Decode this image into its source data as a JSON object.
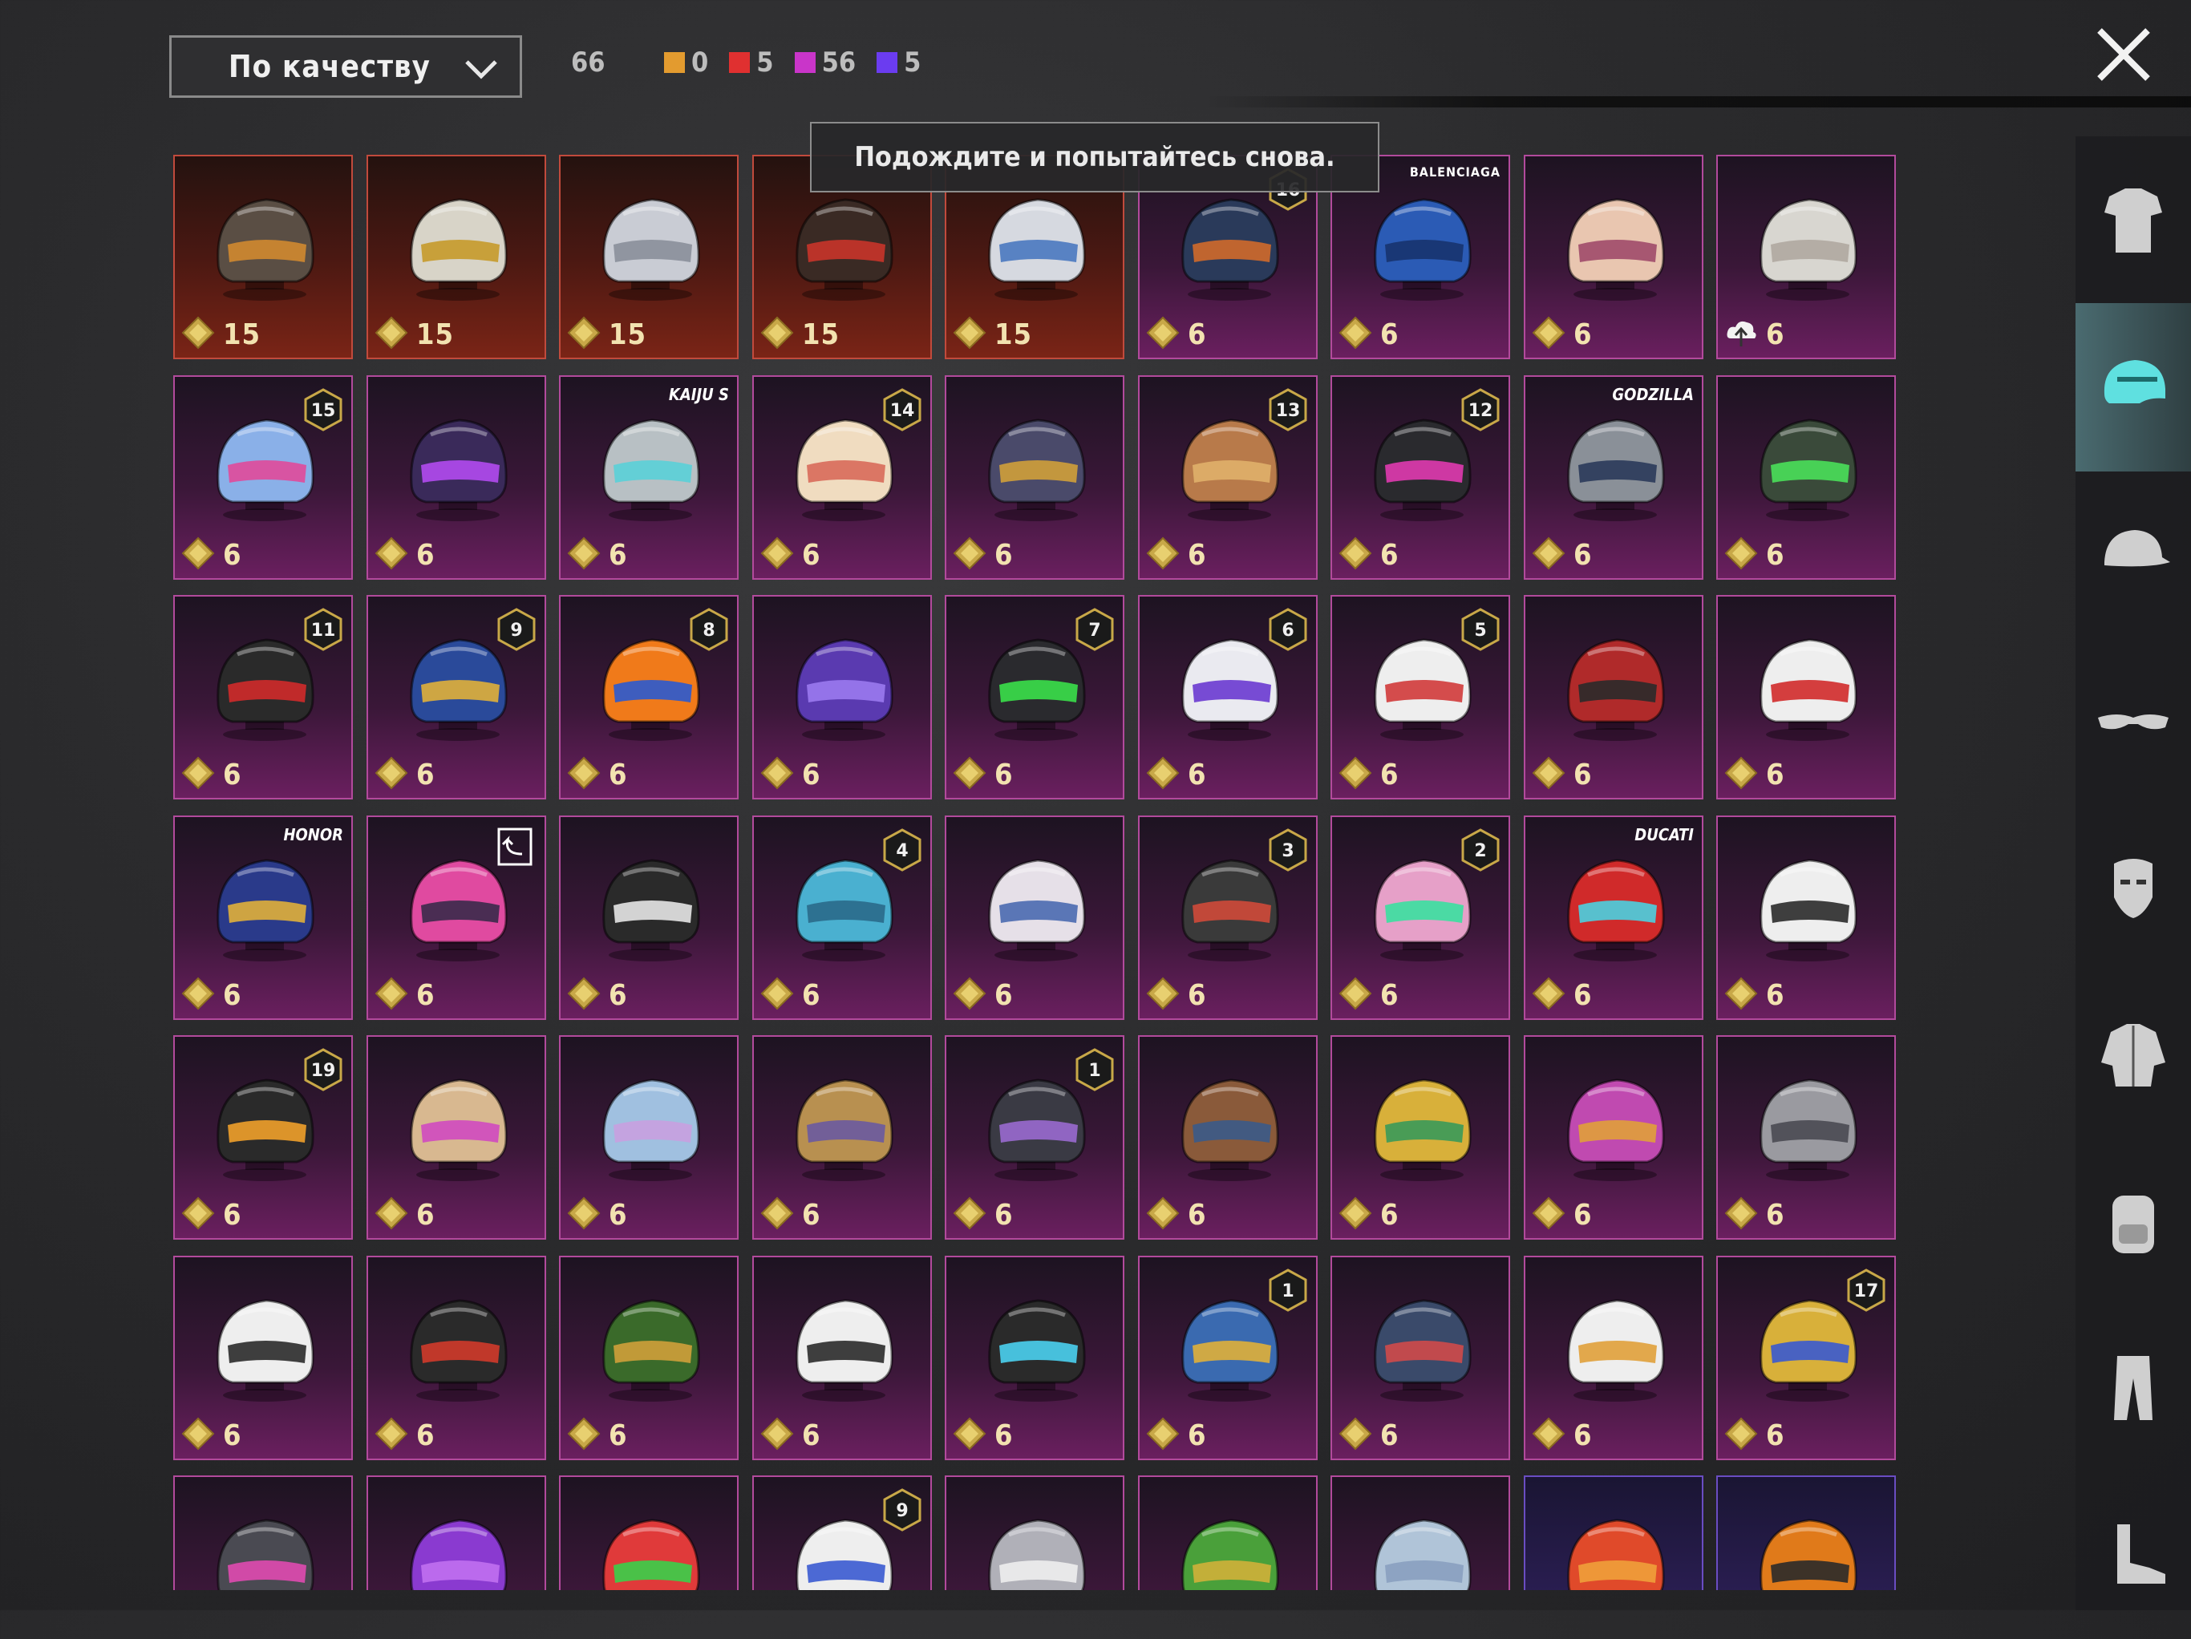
{
  "header": {
    "sort_label": "По качеству",
    "total_count": "66",
    "legend": [
      {
        "color": "#e39b2f",
        "count": "0"
      },
      {
        "color": "#e03030",
        "count": "5"
      },
      {
        "color": "#c935c9",
        "count": "56"
      },
      {
        "color": "#6b3cf0",
        "count": "5"
      }
    ]
  },
  "toast": {
    "message": "Подождите и попытайтесь снова."
  },
  "items": [
    {
      "price": "15",
      "rarity": "red",
      "color": "#5a4e44",
      "accent": "#d08a30"
    },
    {
      "price": "15",
      "rarity": "red",
      "color": "#d8d4c8",
      "accent": "#c69a2a"
    },
    {
      "price": "15",
      "rarity": "red",
      "color": "#c9ccd4",
      "accent": "#8a8f9a"
    },
    {
      "price": "15",
      "rarity": "red",
      "color": "#3a2a24",
      "accent": "#c9342a"
    },
    {
      "price": "15",
      "rarity": "red",
      "color": "#d6d9e0",
      "accent": "#4a78c0"
    },
    {
      "price": "6",
      "rarity": "purple",
      "color": "#2a3a5a",
      "accent": "#d06a2a",
      "badge": "16"
    },
    {
      "price": "6",
      "rarity": "purple",
      "color": "#2b5bb5",
      "accent": "#17336e",
      "brand": "BALENCIAGA"
    },
    {
      "price": "6",
      "rarity": "purple",
      "color": "#e9c6b0",
      "accent": "#a04a6a"
    },
    {
      "price": "6",
      "rarity": "purple",
      "color": "#d8d6d0",
      "accent": "#b0a8a0",
      "upgrade": true
    },
    {
      "price": "6",
      "rarity": "purple",
      "color": "#8ab0e8",
      "accent": "#e04a9a",
      "badge": "15"
    },
    {
      "price": "6",
      "rarity": "purple",
      "color": "#3a2a5a",
      "accent": "#b34af0"
    },
    {
      "price": "6",
      "rarity": "purple",
      "color": "#b8c0c4",
      "accent": "#5ad0d8",
      "brand": "KAIJU S"
    },
    {
      "price": "6",
      "rarity": "purple",
      "color": "#f0dcc0",
      "accent": "#d86a5a",
      "badge": "14"
    },
    {
      "price": "6",
      "rarity": "purple",
      "color": "#4a4a6a",
      "accent": "#d0a03a"
    },
    {
      "price": "6",
      "rarity": "purple",
      "color": "#b87a4a",
      "accent": "#e0b06a",
      "badge": "13"
    },
    {
      "price": "6",
      "rarity": "purple",
      "color": "#2a2a2e",
      "accent": "#e03ab0",
      "badge": "12"
    },
    {
      "price": "6",
      "rarity": "purple",
      "color": "#8a9098",
      "accent": "#2a3a5a",
      "brand": "GODZILLA"
    },
    {
      "price": "6",
      "rarity": "purple",
      "color": "#3a4a3a",
      "accent": "#4ae05a"
    },
    {
      "price": "6",
      "rarity": "purple",
      "color": "#2a2a2a",
      "accent": "#d02a2a",
      "badge": "11"
    },
    {
      "price": "6",
      "rarity": "purple",
      "color": "#2a4a9a",
      "accent": "#e0b03a",
      "badge": "9"
    },
    {
      "price": "6",
      "rarity": "purple",
      "color": "#f07a1a",
      "accent": "#2a5ad0",
      "badge": "8"
    },
    {
      "price": "6",
      "rarity": "purple",
      "color": "#5a3ab0",
      "accent": "#9a7af0"
    },
    {
      "price": "6",
      "rarity": "purple",
      "color": "#2a2a2e",
      "accent": "#3ae04a",
      "badge": "7"
    },
    {
      "price": "6",
      "rarity": "purple",
      "color": "#eaeaf0",
      "accent": "#6a3ad0",
      "badge": "6"
    },
    {
      "price": "6",
      "rarity": "purple",
      "color": "#eeeeee",
      "accent": "#d03a3a",
      "badge": "5"
    },
    {
      "price": "6",
      "rarity": "purple",
      "color": "#b02a2a",
      "accent": "#2a2a2a"
    },
    {
      "price": "6",
      "rarity": "purple",
      "color": "#eeeeee",
      "accent": "#d02a2a"
    },
    {
      "price": "6",
      "rarity": "purple",
      "color": "#2a3a8a",
      "accent": "#e0b03a",
      "brand": "HONOR"
    },
    {
      "price": "6",
      "rarity": "purple",
      "color": "#e04aa0",
      "accent": "#3a2a4a",
      "upgrade_corner": true
    },
    {
      "price": "6",
      "rarity": "purple",
      "color": "#2a2a2a",
      "accent": "#e6e6e6"
    },
    {
      "price": "6",
      "rarity": "purple",
      "color": "#4ab0d0",
      "accent": "#2a6a8a",
      "badge": "4"
    },
    {
      "price": "6",
      "rarity": "purple",
      "color": "#e6e0e8",
      "accent": "#4a6ab0"
    },
    {
      "price": "6",
      "rarity": "purple",
      "color": "#3a3a3a",
      "accent": "#d04a3a",
      "badge": "3"
    },
    {
      "price": "6",
      "rarity": "purple",
      "color": "#e6a0c8",
      "accent": "#3ae0a0",
      "badge": "2"
    },
    {
      "price": "6",
      "rarity": "purple",
      "color": "#d02a2a",
      "accent": "#4ad0e0",
      "brand": "DUCATI"
    },
    {
      "price": "6",
      "rarity": "purple",
      "color": "#eeeeee",
      "accent": "#2a2a2a"
    },
    {
      "price": "6",
      "rarity": "purple",
      "color": "#2a2a2a",
      "accent": "#f0a02a",
      "badge": "19"
    },
    {
      "price": "6",
      "rarity": "purple",
      "color": "#d8b890",
      "accent": "#d04ac0"
    },
    {
      "price": "6",
      "rarity": "purple",
      "color": "#a0c0e0",
      "accent": "#c8a0e0"
    },
    {
      "price": "6",
      "rarity": "purple",
      "color": "#b89050",
      "accent": "#6a5aa0"
    },
    {
      "price": "6",
      "rarity": "purple",
      "color": "#3a3a44",
      "accent": "#9a6ad0",
      "badge": "1"
    },
    {
      "price": "6",
      "rarity": "purple",
      "color": "#8a5a3a",
      "accent": "#3a5a8a"
    },
    {
      "price": "6",
      "rarity": "purple",
      "color": "#d8b03a",
      "accent": "#3a9a5a"
    },
    {
      "price": "6",
      "rarity": "purple",
      "color": "#c04ab0",
      "accent": "#e0a03a"
    },
    {
      "price": "6",
      "rarity": "purple",
      "color": "#9a9aa0",
      "accent": "#4a4a52"
    },
    {
      "price": "6",
      "rarity": "purple",
      "color": "#eeeeee",
      "accent": "#2a2a2a"
    },
    {
      "price": "6",
      "rarity": "purple",
      "color": "#2a2a2a",
      "accent": "#d03a2a"
    },
    {
      "price": "6",
      "rarity": "purple",
      "color": "#3a6a2a",
      "accent": "#d0a03a"
    },
    {
      "price": "6",
      "rarity": "purple",
      "color": "#eeeeee",
      "accent": "#2a2a2a"
    },
    {
      "price": "6",
      "rarity": "purple",
      "color": "#2a2a2a",
      "accent": "#4ad0f0"
    },
    {
      "price": "6",
      "rarity": "purple",
      "color": "#3a6ab0",
      "accent": "#e0b03a",
      "badge": "1"
    },
    {
      "price": "6",
      "rarity": "purple",
      "color": "#3a4a6a",
      "accent": "#d04a4a"
    },
    {
      "price": "6",
      "rarity": "purple",
      "color": "#eeeeee",
      "accent": "#e0a03a"
    },
    {
      "price": "6",
      "rarity": "purple",
      "color": "#d8b03a",
      "accent": "#3a5ad0",
      "badge": "17"
    },
    {
      "price": "",
      "rarity": "purple",
      "color": "#4a4a52",
      "accent": "#e04ab0"
    },
    {
      "price": "",
      "rarity": "purple",
      "color": "#8a3ad0",
      "accent": "#c070f0"
    },
    {
      "price": "",
      "rarity": "purple",
      "color": "#e03a3a",
      "accent": "#3ad04a"
    },
    {
      "price": "",
      "rarity": "purple",
      "color": "#eeeeee",
      "accent": "#3a5ad0",
      "badge": "9"
    },
    {
      "price": "",
      "rarity": "purple",
      "color": "#b0b0b8",
      "accent": "#eeeeee"
    },
    {
      "price": "",
      "rarity": "purple",
      "color": "#4aa03a",
      "accent": "#d0b03a"
    },
    {
      "price": "",
      "rarity": "purple",
      "color": "#b0c4d8",
      "accent": "#8aa0c0"
    },
    {
      "price": "",
      "rarity": "blue",
      "color": "#e04a2a",
      "accent": "#f0a03a"
    },
    {
      "price": "",
      "rarity": "blue",
      "color": "#e07a1a",
      "accent": "#2a2a2a"
    }
  ],
  "sidebar": [
    {
      "name": "outfit",
      "active": false
    },
    {
      "name": "helmet",
      "active": true
    },
    {
      "name": "hat",
      "active": false
    },
    {
      "name": "glasses",
      "active": false
    },
    {
      "name": "mask",
      "active": false
    },
    {
      "name": "jacket",
      "active": false
    },
    {
      "name": "backpack",
      "active": false
    },
    {
      "name": "pants",
      "active": false
    },
    {
      "name": "shoes",
      "active": false
    }
  ]
}
